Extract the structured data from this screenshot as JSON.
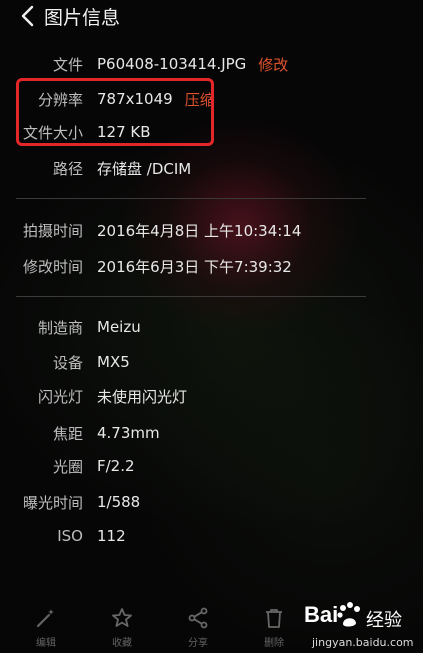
{
  "header": {
    "title": "图片信息"
  },
  "info_rows": [
    {
      "label": "文件",
      "value": "P60408-103414.JPG",
      "action": "修改"
    },
    {
      "label": "分辨率",
      "value": "787x1049",
      "action": "压缩"
    },
    {
      "label": "文件大小",
      "value": "127 KB"
    },
    {
      "label": "路径",
      "value": "存储盘 /DCIM"
    },
    {
      "label": "拍摄时间",
      "value": "2016年4月8日 上午10:34:14"
    },
    {
      "label": "修改时间",
      "value": "2016年6月3日 下午7:39:32"
    },
    {
      "label": "制造商",
      "value": "Meizu"
    },
    {
      "label": "设备",
      "value": "MX5"
    },
    {
      "label": "闪光灯",
      "value": "未使用闪光灯"
    },
    {
      "label": "焦距",
      "value": "4.73mm"
    },
    {
      "label": "光圈",
      "value": "F/2.2"
    },
    {
      "label": "曝光时间",
      "value": "1/588"
    },
    {
      "label": "ISO",
      "value": "112"
    }
  ],
  "toolbar": [
    {
      "label": "编辑",
      "icon": "magic-wand-icon"
    },
    {
      "label": "收藏",
      "icon": "star-icon"
    },
    {
      "label": "分享",
      "icon": "share-icon"
    },
    {
      "label": "删除",
      "icon": "trash-icon"
    }
  ],
  "watermark": {
    "brand": "Bai",
    "suffix": "经验",
    "url": "jingyan.baidu.com"
  },
  "colors": {
    "action": "#e0522d",
    "highlight": "#e3262a"
  }
}
